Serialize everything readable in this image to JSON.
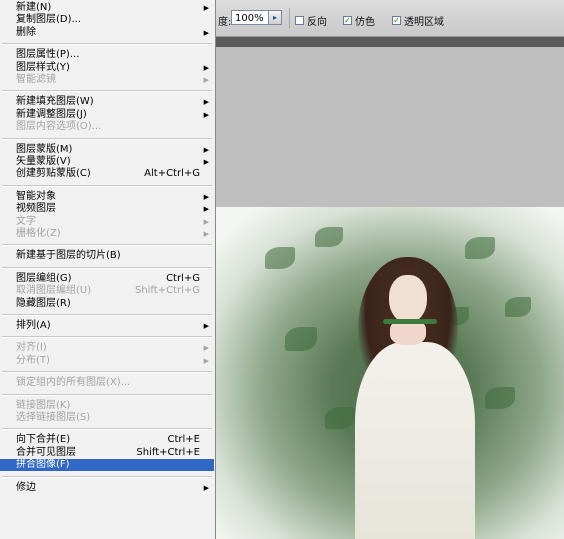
{
  "options_bar": {
    "opacity_label": "度:",
    "opacity_value": "100%",
    "checkboxes": [
      {
        "label": "反向",
        "checked": false
      },
      {
        "label": "仿色",
        "checked": true
      },
      {
        "label": "透明区域",
        "checked": true
      }
    ]
  },
  "menu": {
    "groups": [
      [
        {
          "label": "新建(N)",
          "submenu": true,
          "enabled": true
        },
        {
          "label": "复制图层(D)...",
          "submenu": false,
          "enabled": true
        },
        {
          "label": "删除",
          "submenu": true,
          "enabled": true
        }
      ],
      [
        {
          "label": "图层属性(P)...",
          "submenu": false,
          "enabled": true
        },
        {
          "label": "图层样式(Y)",
          "submenu": true,
          "enabled": true
        },
        {
          "label": "智能滤镜",
          "submenu": true,
          "enabled": false
        }
      ],
      [
        {
          "label": "新建填充图层(W)",
          "submenu": true,
          "enabled": true
        },
        {
          "label": "新建调整图层(J)",
          "submenu": true,
          "enabled": true
        },
        {
          "label": "图层内容选项(O)...",
          "submenu": false,
          "enabled": false
        }
      ],
      [
        {
          "label": "图层蒙版(M)",
          "submenu": true,
          "enabled": true
        },
        {
          "label": "矢量蒙版(V)",
          "submenu": true,
          "enabled": true
        },
        {
          "label": "创建剪贴蒙版(C)",
          "shortcut": "Alt+Ctrl+G",
          "enabled": true
        }
      ],
      [
        {
          "label": "智能对象",
          "submenu": true,
          "enabled": true
        },
        {
          "label": "视频图层",
          "submenu": true,
          "enabled": true
        },
        {
          "label": "文字",
          "submenu": true,
          "enabled": false
        },
        {
          "label": "栅格化(Z)",
          "submenu": true,
          "enabled": false
        }
      ],
      [
        {
          "label": "新建基于图层的切片(B)",
          "enabled": true
        }
      ],
      [
        {
          "label": "图层编组(G)",
          "shortcut": "Ctrl+G",
          "enabled": true
        },
        {
          "label": "取消图层编组(U)",
          "shortcut": "Shift+Ctrl+G",
          "enabled": false
        },
        {
          "label": "隐藏图层(R)",
          "enabled": true
        }
      ],
      [
        {
          "label": "排列(A)",
          "submenu": true,
          "enabled": true
        }
      ],
      [
        {
          "label": "对齐(I)",
          "submenu": true,
          "enabled": false
        },
        {
          "label": "分布(T)",
          "submenu": true,
          "enabled": false
        }
      ],
      [
        {
          "label": "锁定组内的所有图层(X)...",
          "enabled": false
        }
      ],
      [
        {
          "label": "链接图层(K)",
          "enabled": false
        },
        {
          "label": "选择链接图层(S)",
          "enabled": false
        }
      ],
      [
        {
          "label": "向下合并(E)",
          "shortcut": "Ctrl+E",
          "enabled": true
        },
        {
          "label": "合并可见图层",
          "shortcut": "Shift+Ctrl+E",
          "enabled": true
        },
        {
          "label": "拼合图像(F)",
          "enabled": true,
          "highlighted": true
        }
      ],
      [
        {
          "label": "修边",
          "submenu": true,
          "enabled": true
        }
      ]
    ]
  }
}
